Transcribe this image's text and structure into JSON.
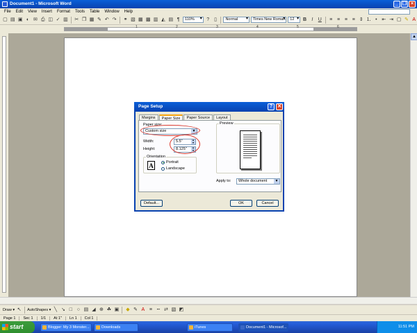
{
  "window": {
    "title": "Document1 - Microsoft Word"
  },
  "menu": [
    "File",
    "Edit",
    "View",
    "Insert",
    "Format",
    "Tools",
    "Table",
    "Window",
    "Help"
  ],
  "toolbar": {
    "zoom": "110%",
    "style": "Normal",
    "font": "Times New Roman",
    "size": "12",
    "icons": [
      "new-icon",
      "open-icon",
      "save-icon",
      "permission-icon",
      "email-icon",
      "print-icon",
      "print-preview-icon",
      "spelling-icon",
      "research-icon",
      "cut-icon",
      "copy-icon",
      "paste-icon",
      "format-painter-icon",
      "undo-icon",
      "redo-icon",
      "hyperlink-icon",
      "tables-borders-icon",
      "insert-table-icon",
      "insert-excel-icon",
      "columns-icon",
      "drawing-icon",
      "document-map-icon",
      "show-hide-icon",
      "help-icon"
    ],
    "format_labels": [
      "B",
      "I",
      "U"
    ]
  },
  "ruler": {
    "marks": [
      "1",
      "2",
      "3",
      "4",
      "5",
      "6"
    ]
  },
  "dialog": {
    "title": "Page Setup",
    "help_btn": "?",
    "close_btn": "✕",
    "tabs": [
      "Margins",
      "Paper Size",
      "Paper Source",
      "Layout"
    ],
    "paper_size_label": "Paper size:",
    "paper_size_value": "Custom size",
    "width_label": "Width:",
    "width_value": "5.5\"",
    "height_label": "Height:",
    "height_value": "8.125\"",
    "orientation_label": "Orientation",
    "orientation_icon_letter": "A",
    "portrait_label": "Portrait",
    "landscape_label": "Landscape",
    "preview_label": "Preview",
    "apply_to_label": "Apply to:",
    "apply_to_value": "Whole document",
    "default_btn": "Default...",
    "ok_btn": "OK",
    "cancel_btn": "Cancel"
  },
  "drawbar": {
    "draw": "Draw ▾",
    "autoshapes": "AutoShapes ▾"
  },
  "status": [
    "Page 1",
    "Sec 1",
    "1/1",
    "At 1\"",
    "Ln 1",
    "Col 1"
  ],
  "taskbar": {
    "start": "start",
    "tasks": [
      "Blogger: My 3 Monster...",
      "Downloads",
      "iTunes",
      "Document1 - Microsof..."
    ],
    "clock": "11:51 PM"
  },
  "annotation_color": "#d9372b"
}
